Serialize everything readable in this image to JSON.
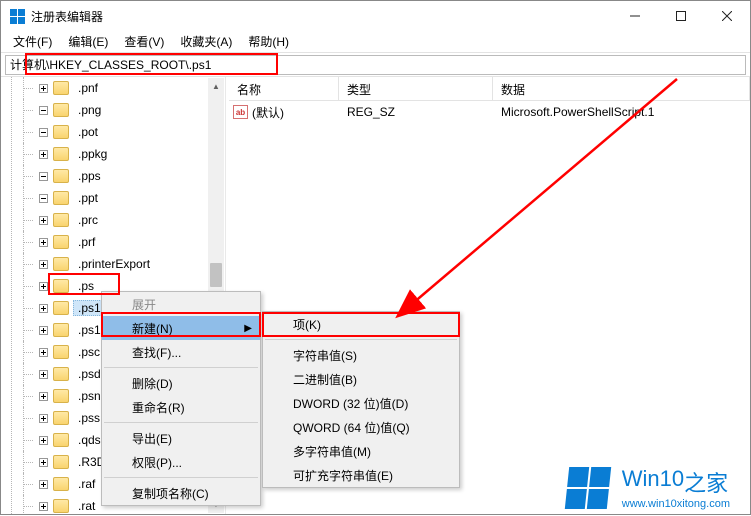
{
  "window": {
    "title": "注册表编辑器"
  },
  "menubar": [
    "文件(F)",
    "编辑(E)",
    "查看(V)",
    "收藏夹(A)",
    "帮助(H)"
  ],
  "address": "计算机\\HKEY_CLASSES_ROOT\\.ps1",
  "tree": {
    "items": [
      {
        "label": ".pnf",
        "exp": false
      },
      {
        "label": ".png",
        "exp": true
      },
      {
        "label": ".pot",
        "exp": true
      },
      {
        "label": ".ppkg",
        "exp": false
      },
      {
        "label": ".pps",
        "exp": true
      },
      {
        "label": ".ppt",
        "exp": true
      },
      {
        "label": ".prc",
        "exp": false
      },
      {
        "label": ".prf",
        "exp": false
      },
      {
        "label": ".printerExport",
        "exp": false
      },
      {
        "label": ".ps",
        "exp": false
      },
      {
        "label": ".ps1",
        "exp": false,
        "sel": true
      },
      {
        "label": ".ps1",
        "exp": false
      },
      {
        "label": ".psc",
        "exp": false
      },
      {
        "label": ".psd",
        "exp": false
      },
      {
        "label": ".psn",
        "exp": false
      },
      {
        "label": ".pss",
        "exp": false
      },
      {
        "label": ".qds",
        "exp": false
      },
      {
        "label": ".R3D",
        "exp": false
      },
      {
        "label": ".raf",
        "exp": false
      },
      {
        "label": ".rat",
        "exp": false
      }
    ]
  },
  "list": {
    "headers": {
      "name": "名称",
      "type": "类型",
      "data": "数据"
    },
    "rows": [
      {
        "icon": "ab",
        "name": "(默认)",
        "type": "REG_SZ",
        "data": "Microsoft.PowerShellScript.1"
      }
    ]
  },
  "ctx1": {
    "expand": "展开",
    "new": "新建(N)",
    "find": "查找(F)...",
    "delete": "删除(D)",
    "rename": "重命名(R)",
    "export": "导出(E)",
    "perm": "权限(P)...",
    "copyname": "复制项名称(C)"
  },
  "ctx2": {
    "key": "项(K)",
    "string": "字符串值(S)",
    "binary": "二进制值(B)",
    "dword": "DWORD (32 位)值(D)",
    "qword": "QWORD (64 位)值(Q)",
    "multi": "多字符串值(M)",
    "expand": "可扩充字符串值(E)"
  },
  "logo": {
    "main": "Win10",
    "suffix": "之家",
    "url": "www.win10xitong.com"
  }
}
